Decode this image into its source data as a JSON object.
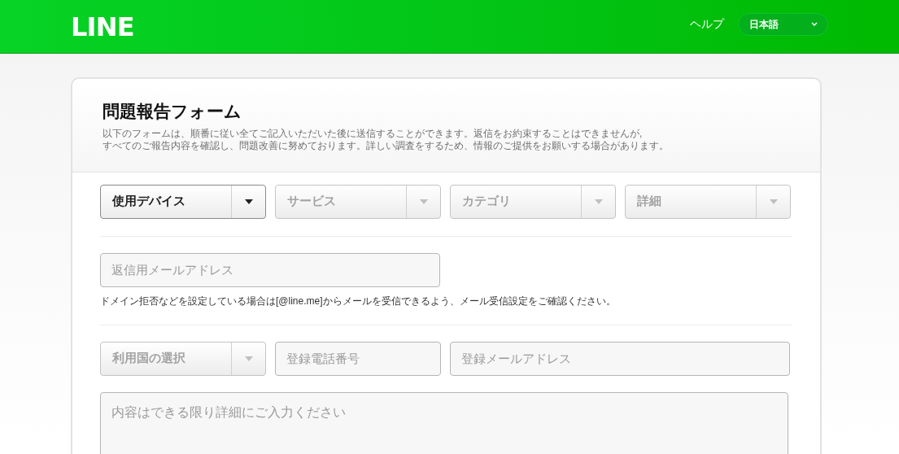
{
  "header": {
    "logo": "LINE",
    "help_link": "ヘルプ",
    "language": "日本語"
  },
  "form": {
    "title": "問題報告フォーム",
    "description": [
      "以下のフォームは、順番に従い全てご記入いただいた後に送信することができます。返信をお約束することはできませんが,",
      "すべてのご報告内容を確認し、問題改善に努めております。詳しい調査をするため、情報のご提供をお願いする場合があります。"
    ],
    "selects": [
      {
        "label": "使用デバイス",
        "disabled": false
      },
      {
        "label": "サービス",
        "disabled": true
      },
      {
        "label": "カテゴリ",
        "disabled": true
      },
      {
        "label": "詳細",
        "disabled": true
      }
    ],
    "reply_email": {
      "placeholder": "返信用メールアドレス"
    },
    "reply_note": "ドメイン拒否などを設定している場合は[@line.me]からメールを受信できるよう、メール受信設定をご確認ください。",
    "country_select": {
      "label": "利用国の選択",
      "disabled": true
    },
    "phone": {
      "placeholder": "登録電話番号"
    },
    "registered_email": {
      "placeholder": "登録メールアドレス"
    },
    "details": {
      "placeholder": "内容はできる限り詳細にご入力ください"
    }
  }
}
